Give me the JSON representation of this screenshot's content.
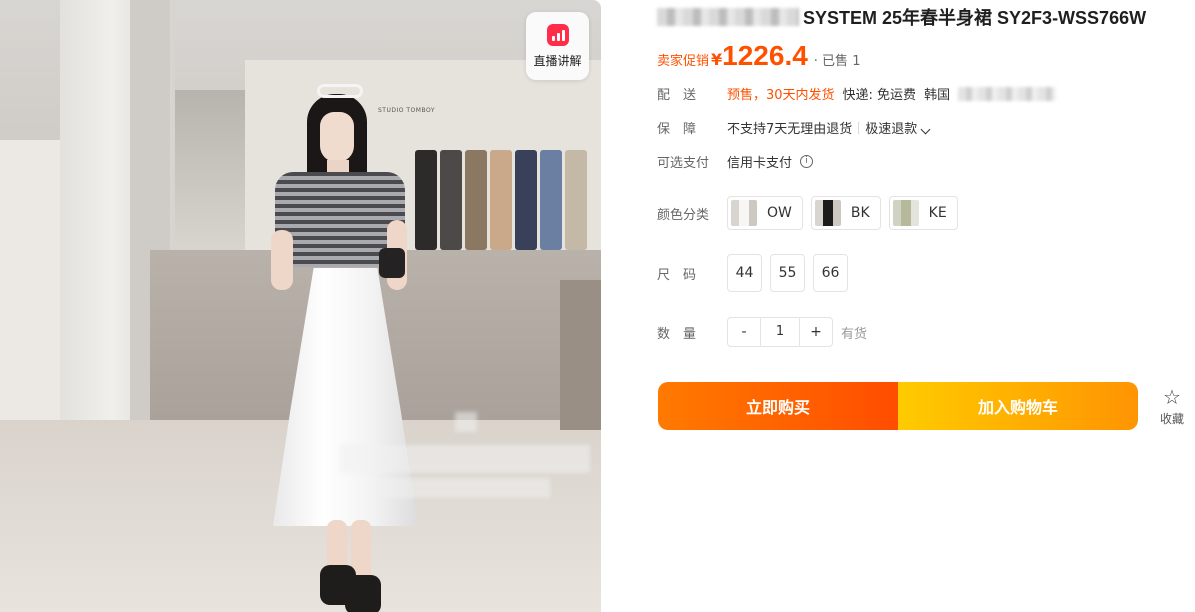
{
  "product": {
    "title": "SYSTEM 25年春半身裙 SY2F3-WSS766W",
    "price": {
      "promo_label": "卖家促销",
      "currency": "¥",
      "amount": "1226.4",
      "sold": "· 已售 1"
    }
  },
  "live_badge": {
    "label": "直播讲解",
    "icon": "live-stats-icon"
  },
  "shipping": {
    "label": "配　送",
    "presale": "预售，30天内发货",
    "express": "快递: 免运费",
    "origin": "韩国"
  },
  "guarantee": {
    "label": "保　障",
    "no_return": "不支持7天无理由退货",
    "fast_refund": "极速退款"
  },
  "payment": {
    "label": "可选支付",
    "method": "信用卡支付"
  },
  "color": {
    "label": "颜色分类",
    "options": [
      {
        "name": "OW"
      },
      {
        "name": "BK"
      },
      {
        "name": "KE"
      }
    ]
  },
  "size": {
    "label": "尺　码",
    "options": [
      "44",
      "55",
      "66"
    ]
  },
  "quantity": {
    "label": "数　量",
    "minus": "-",
    "value": "1",
    "plus": "+",
    "stock": "有货"
  },
  "actions": {
    "buy_now": "立即购买",
    "add_to_cart": "加入购物车",
    "favorite": "收藏"
  },
  "photo": {
    "store_sign": "STUDIO TOMBOY"
  },
  "colors": {
    "accent": "#ff5000",
    "buy_gradient": [
      "#ff7a00",
      "#ff4d00"
    ],
    "cart_gradient": [
      "#ffcb00",
      "#ff9402"
    ],
    "live_red": "#ff2d4a"
  }
}
